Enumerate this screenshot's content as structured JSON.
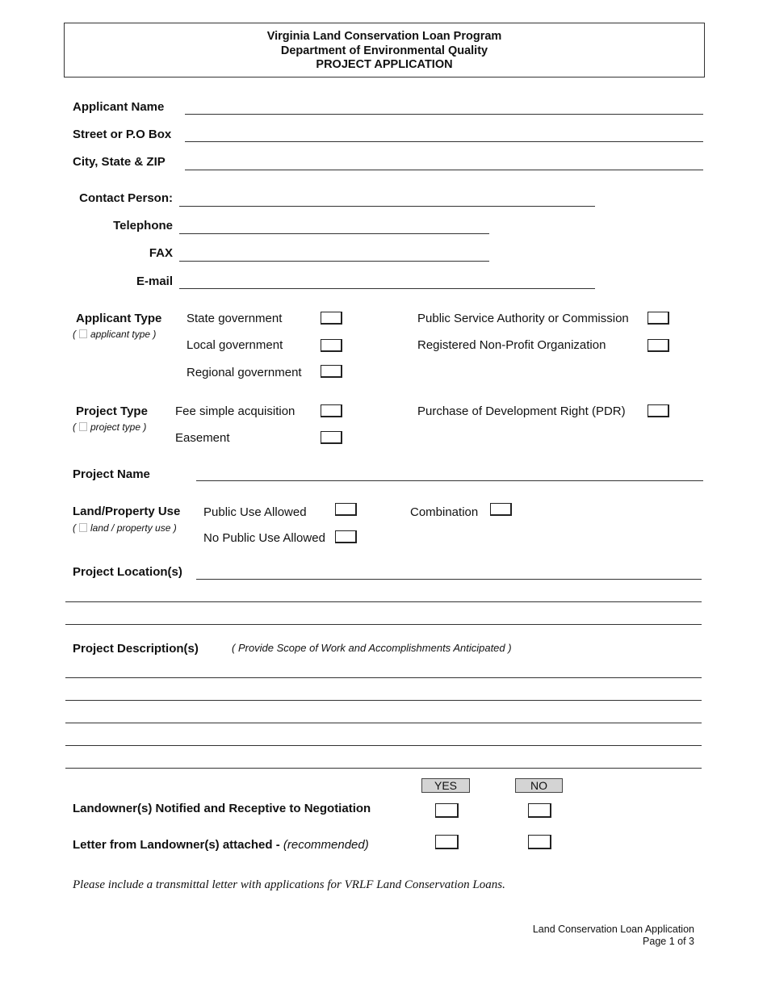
{
  "header": {
    "line1": "Virginia Land Conservation Loan Program",
    "line2": "Department of Environmental Quality",
    "line3": "PROJECT APPLICATION"
  },
  "applicant": {
    "name_label": "Applicant Name",
    "street_label": "Street or P.O Box",
    "city_label": "City, State & ZIP",
    "contact_label": "Contact Person:",
    "telephone_label": "Telephone",
    "fax_label": "FAX",
    "email_label": "E-mail"
  },
  "applicant_type": {
    "label": "Applicant Type",
    "hint": "applicant type",
    "options": [
      "State government",
      "Local government",
      "Regional government",
      "Public Service Authority or Commission",
      "Registered Non-Profit Organization"
    ]
  },
  "project_type": {
    "label": "Project Type",
    "hint": "project  type",
    "options": [
      "Fee simple acquisition",
      "Easement",
      "Purchase of Development Right (PDR)"
    ]
  },
  "project_name": {
    "label": "Project Name"
  },
  "land_use": {
    "label": "Land/Property Use",
    "hint": "land / property use",
    "options": [
      "Public Use Allowed",
      "No Public Use Allowed",
      "Combination"
    ]
  },
  "project_location": {
    "label": "Project Location(s)"
  },
  "project_description": {
    "label": "Project Description(s)",
    "hint": "( Provide Scope of Work and Accomplishments Anticipated )"
  },
  "landowner": {
    "yes_label": "YES",
    "no_label": "NO",
    "q1": "Landowner(s) Notified and Receptive to Negotiation",
    "q2": "Letter from Landowner(s) attached - ",
    "q2_note": "(recommended)"
  },
  "note": "Please include a transmittal letter with applications for VRLF Land Conservation Loans.",
  "footer": {
    "line1": "Land Conservation Loan Application",
    "line2": "Page 1 of 3"
  }
}
